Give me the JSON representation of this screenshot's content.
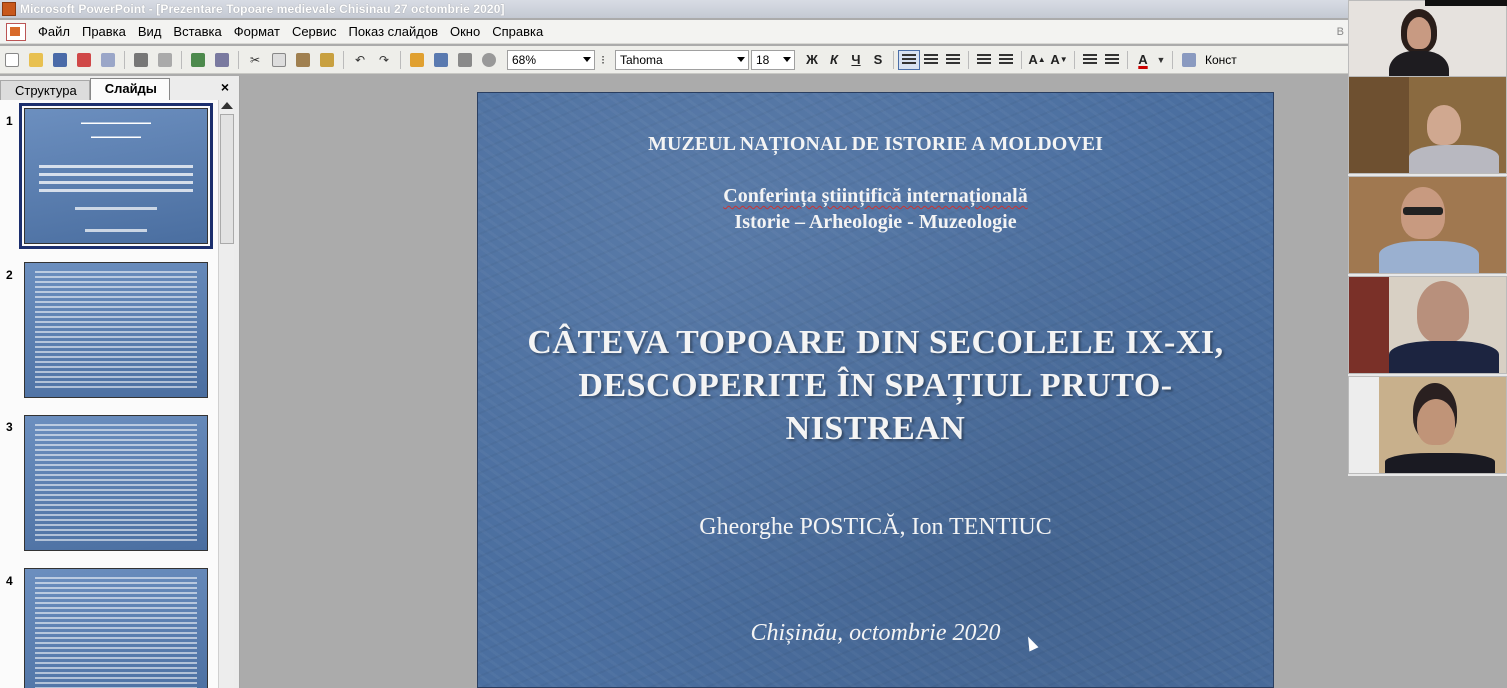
{
  "window": {
    "title": "Microsoft PowerPoint - [Prezentare Topoare medievale Chisinau 27 octombrie 2020]"
  },
  "menu": {
    "items": [
      "Файл",
      "Правка",
      "Вид",
      "Вставка",
      "Формат",
      "Сервис",
      "Показ слайдов",
      "Окно",
      "Справка"
    ],
    "right_text": "В"
  },
  "toolbar": {
    "zoom": "68%",
    "font": "Tahoma",
    "font_size": "18",
    "bold": "Ж",
    "italic": "К",
    "underline": "Ч",
    "shadow": "S",
    "font_color": "A",
    "design_label": "Конст"
  },
  "panel": {
    "tab_outline": "Структура",
    "tab_slides": "Слайды",
    "close": "×",
    "thumbnails": [
      {
        "num": "1"
      },
      {
        "num": "2"
      },
      {
        "num": "3"
      },
      {
        "num": "4"
      }
    ]
  },
  "slide": {
    "museum": "MUZEUL NAȚIONAL DE ISTORIE A MOLDOVEI",
    "conference_line1": "Conferința științifică internațională",
    "conference_line2": "Istorie – Arheologie - Muzeologie",
    "main_title": "CÂTEVA TOPOARE DIN SECOLELE IX-XI, DESCOPERITE ÎN SPAȚIUL PRUTO-NISTREAN",
    "authors": "Gheorghe POSTICĂ, Ion TENTIUC",
    "place_date": "Chișinău, octombrie 2020"
  },
  "colors": {
    "slide_bg": "#4B6FA0",
    "selected_outline": "#1C2F6E"
  }
}
